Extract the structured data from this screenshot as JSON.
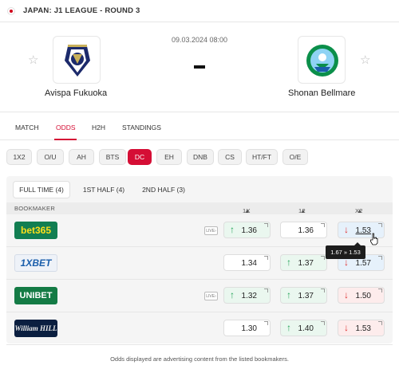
{
  "header": {
    "league": "JAPAN: J1 LEAGUE - ROUND 3"
  },
  "match": {
    "date": "09.03.2024 08:00",
    "home": {
      "name": "Avispa Fukuoka",
      "logo": "avispa-fukuoka-logo"
    },
    "away": {
      "name": "Shonan Bellmare",
      "logo": "shonan-bellmare-logo"
    }
  },
  "tabs": [
    "MATCH",
    "ODDS",
    "H2H",
    "STANDINGS"
  ],
  "active_tab": "ODDS",
  "bet_types": [
    "1X2",
    "O/U",
    "AH",
    "BTS",
    "DC",
    "EH",
    "DNB",
    "CS",
    "HT/FT",
    "O/E"
  ],
  "active_bet_type": "DC",
  "periods": [
    "FULL TIME (4)",
    "1ST HALF (4)",
    "2ND HALF (3)"
  ],
  "table": {
    "bookmaker_header": "BOOKMAKER",
    "columns": [
      "1X",
      "12",
      "X2"
    ],
    "rows": [
      {
        "bookmaker": "bet365",
        "live": "LIVE",
        "odds": [
          "1.36",
          "1.36",
          "1.53"
        ],
        "trend": [
          "up",
          "none",
          "down"
        ]
      },
      {
        "bookmaker": "1XBET",
        "live": "",
        "odds": [
          "1.34",
          "1.37",
          "1.57"
        ],
        "trend": [
          "none",
          "up",
          "down"
        ]
      },
      {
        "bookmaker": "UNIBET",
        "live": "LIVE",
        "odds": [
          "1.32",
          "1.37",
          "1.50"
        ],
        "trend": [
          "up",
          "up",
          "down"
        ]
      },
      {
        "bookmaker": "William HILL",
        "live": "",
        "odds": [
          "1.30",
          "1.40",
          "1.53"
        ],
        "trend": [
          "none",
          "up",
          "down"
        ]
      }
    ]
  },
  "tooltip": "1.67 » 1.53",
  "footer": "Odds displayed are advertising content from the listed bookmakers.",
  "colors": {
    "accent": "#d50e35",
    "up": "#25a55a",
    "down": "#e03131"
  }
}
